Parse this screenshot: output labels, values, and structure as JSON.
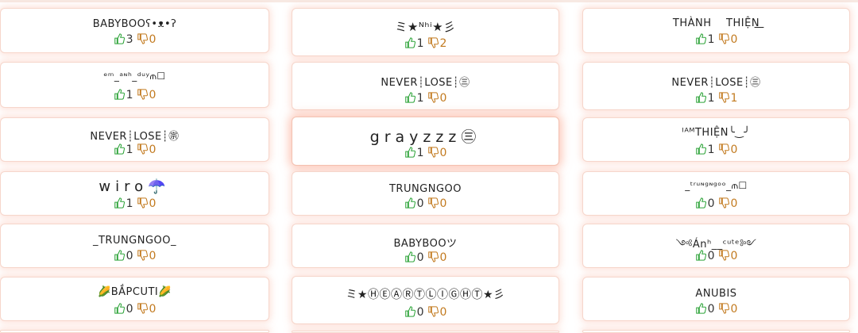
{
  "colors": {
    "like": "#2ea43a",
    "dislike": "#c27a1f",
    "card_glow": "#faa991"
  },
  "icons": {
    "like": "thumbs-up-icon",
    "dislike": "thumbs-down-icon"
  },
  "cards": [
    {
      "name": "BABYBOOʕ•ᴥ•ʔ",
      "likes": "3",
      "dislikes": "0"
    },
    {
      "name": "ミ★ᴺʰⁱ★彡",
      "likes": "1",
      "dislikes": "2"
    },
    {
      "name": "THÀNH    THIỆN͟͟",
      "likes": "1",
      "dislikes": "0"
    },
    {
      "name": "ᵉᵐ_ᵃᶰʰ_ᵈᵘʸ⫙☐",
      "likes": "1",
      "dislikes": "0"
    },
    {
      "name": "NEVER┊LOSE┊㊂",
      "likes": "1",
      "dislikes": "0"
    },
    {
      "name": "NEVER┊LOSE┊㊂",
      "likes": "1",
      "dislikes": "1"
    },
    {
      "name": "NEVER┊LOSE┊㊪",
      "likes": "1",
      "dislikes": "0"
    },
    {
      "name": "grayzzz㊂",
      "likes": "1",
      "dislikes": "0"
    },
    {
      "name": "ᴵᴬᴹTHIỆN╰‿╯",
      "likes": "1",
      "dislikes": "0"
    },
    {
      "name": "wiro☂️",
      "likes": "1",
      "dislikes": "0"
    },
    {
      "name": "TRUNGNGOO",
      "likes": "0",
      "dislikes": "0"
    },
    {
      "name": "_ᵗʳᵘᶰᵍᶰᵍᵒᵒ_⫙☐",
      "likes": "0",
      "dislikes": "0"
    },
    {
      "name": "_TRUNGNGOO_",
      "likes": "0",
      "dislikes": "0"
    },
    {
      "name": "BABYBOOツ",
      "likes": "0",
      "dislikes": "0"
    },
    {
      "name": "༺Ánʰ__ᶜᵘᵗᵉ༻",
      "likes": "0",
      "dislikes": "0"
    },
    {
      "name": "🌽BẮPCUTI🌽",
      "likes": "0",
      "dislikes": "0"
    },
    {
      "name": "ミ★ⒽⒺⒶⓇⓉⓁⒾⒼⒽⓉ★彡",
      "likes": "0",
      "dislikes": "0"
    },
    {
      "name": "ANUBIS",
      "likes": "0",
      "dislikes": "0"
    }
  ]
}
